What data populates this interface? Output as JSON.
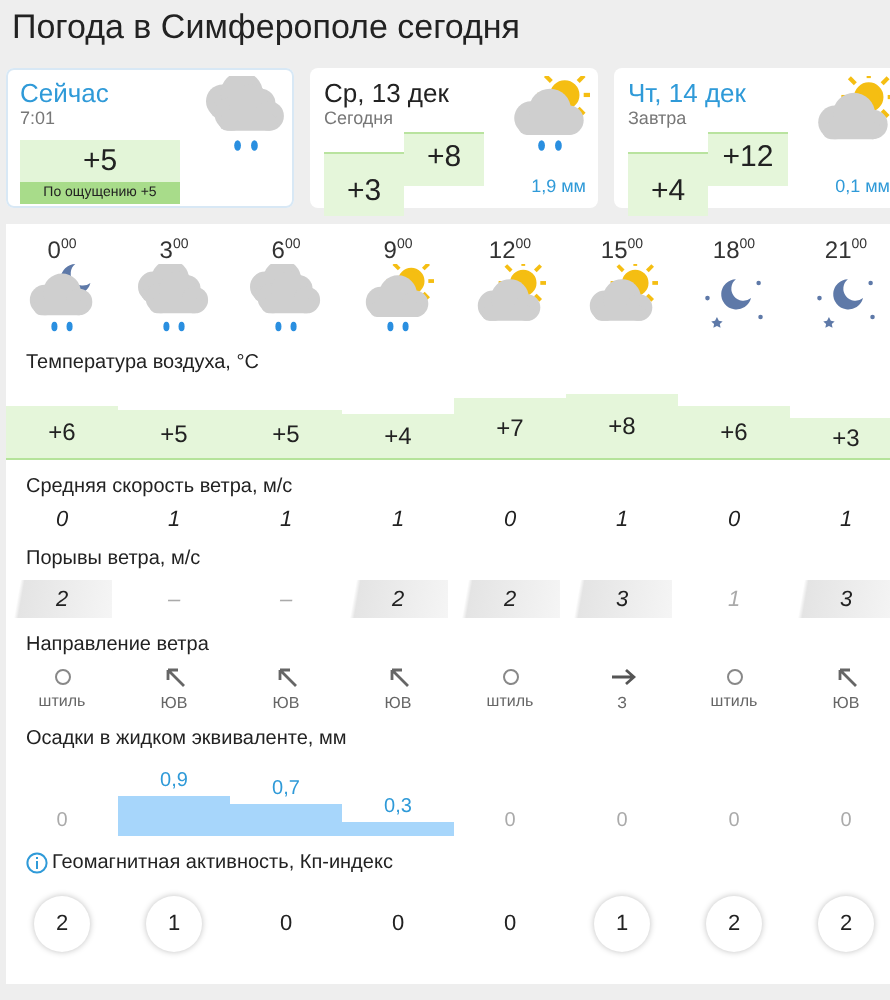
{
  "title": "Погода в Симферополе сегодня",
  "cards": [
    {
      "kind": "now",
      "selected": true,
      "heading": "Сейчас",
      "sub": "7:01",
      "temp": "+5",
      "feels": "По ощущению +5"
    },
    {
      "kind": "day",
      "selected": false,
      "heading": "Ср, 13 дек",
      "sub": "Сегодня",
      "low": "+3",
      "high": "+8",
      "precip": "1,9 мм"
    },
    {
      "kind": "day",
      "selected": false,
      "heading": "Чт, 14 дек",
      "sub": "Завтра",
      "low": "+4",
      "high": "+12",
      "precip": "0,1 мм"
    }
  ],
  "hours": [
    {
      "hour": "0",
      "minutes": "00",
      "kind": "moon-cloud-rain"
    },
    {
      "hour": "3",
      "minutes": "00",
      "kind": "cloud-rain"
    },
    {
      "hour": "6",
      "minutes": "00",
      "kind": "cloud-rain"
    },
    {
      "hour": "9",
      "minutes": "00",
      "kind": "sun-cloud-rain"
    },
    {
      "hour": "12",
      "minutes": "00",
      "kind": "sun-cloud"
    },
    {
      "hour": "15",
      "minutes": "00",
      "kind": "sun-cloud"
    },
    {
      "hour": "18",
      "minutes": "00",
      "kind": "moon-stars"
    },
    {
      "hour": "21",
      "minutes": "00",
      "kind": "moon-stars"
    }
  ],
  "temperature": {
    "label": "Температура воздуха, °C",
    "values": [
      "+6",
      "+5",
      "+5",
      "+4",
      "+7",
      "+8",
      "+6",
      "+3"
    ]
  },
  "wind_speed": {
    "label": "Средняя скорость ветра, м/с",
    "values": [
      "0",
      "1",
      "1",
      "1",
      "0",
      "1",
      "0",
      "1"
    ]
  },
  "gusts": {
    "label": "Порывы ветра, м/с",
    "values": [
      {
        "value": "2",
        "highlighted": true
      },
      {
        "value": "–",
        "highlighted": false
      },
      {
        "value": "–",
        "highlighted": false
      },
      {
        "value": "2",
        "highlighted": true
      },
      {
        "value": "2",
        "highlighted": true
      },
      {
        "value": "3",
        "highlighted": true
      },
      {
        "value": "1",
        "highlighted": false
      },
      {
        "value": "3",
        "highlighted": true
      }
    ]
  },
  "wind_direction": {
    "label": "Направление ветра",
    "values": [
      {
        "kind": "calm",
        "text": "штиль"
      },
      {
        "kind": "northwest",
        "text": "ЮВ"
      },
      {
        "kind": "northwest",
        "text": "ЮВ"
      },
      {
        "kind": "northwest",
        "text": "ЮВ"
      },
      {
        "kind": "calm",
        "text": "штиль"
      },
      {
        "kind": "east",
        "text": "З"
      },
      {
        "kind": "calm",
        "text": "штиль"
      },
      {
        "kind": "northwest",
        "text": "ЮВ"
      }
    ]
  },
  "precipitation": {
    "label": "Осадки в жидком эквиваленте, мм",
    "values": [
      {
        "value": "0",
        "kind": "zero"
      },
      {
        "value": "0,9",
        "kind": "bar"
      },
      {
        "value": "0,7",
        "kind": "bar"
      },
      {
        "value": "0,3",
        "kind": "bar"
      },
      {
        "value": "0",
        "kind": "zero"
      },
      {
        "value": "0",
        "kind": "zero"
      },
      {
        "value": "0",
        "kind": "zero"
      },
      {
        "value": "0",
        "kind": "zero"
      }
    ]
  },
  "geomagnetic": {
    "label": "Геомагнитная активность, Кп-индекс",
    "values": [
      {
        "value": "2",
        "circled": true
      },
      {
        "value": "1",
        "circled": true
      },
      {
        "value": "0",
        "circled": false
      },
      {
        "value": "0",
        "circled": false
      },
      {
        "value": "0",
        "circled": false
      },
      {
        "value": "1",
        "circled": true
      },
      {
        "value": "2",
        "circled": true
      },
      {
        "value": "2",
        "circled": true
      }
    ]
  }
}
